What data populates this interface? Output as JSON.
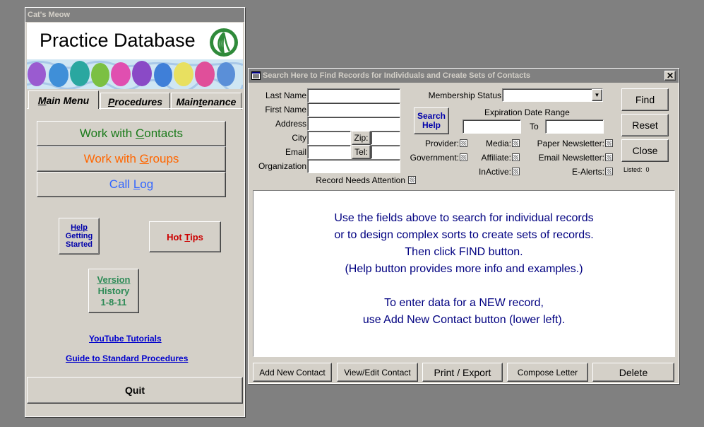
{
  "left_window": {
    "title": "Cat's Meow",
    "header_title": "Practice Database",
    "tabs": [
      {
        "label": "Main Menu",
        "u": "M"
      },
      {
        "label": "Procedures",
        "u": "P"
      },
      {
        "label": "Maintenance",
        "u": "t"
      }
    ],
    "buttons": {
      "contacts": {
        "pre": "Work with ",
        "u": "C",
        "post": "ontacts",
        "color": "#1a7a1a"
      },
      "groups": {
        "pre": "Work with ",
        "u": "G",
        "post": "roups",
        "color": "#ff6600"
      },
      "call_log": {
        "pre": "Call ",
        "u": "L",
        "post": "og",
        "color": "#3366ff"
      },
      "help": {
        "u": "H",
        "l1": "elp",
        "l2": "Getting",
        "l3": "Started",
        "color": "#0000aa"
      },
      "hot_tips": {
        "pre": "Hot ",
        "u": "T",
        "post": "ips",
        "color": "#cc0000"
      },
      "version": {
        "u": "V",
        "l1": "ersion",
        "l2": "History",
        "l3": "1-8-11",
        "color": "#2e8b57"
      },
      "quit": "Quit"
    },
    "links": {
      "youtube": "YouTube Tutorials",
      "guide": "Guide to Standard Procedures"
    }
  },
  "search_window": {
    "title": "Search Here to Find Records for Individuals and Create Sets of Contacts",
    "labels": {
      "last_name": "Last Name",
      "first_name": "First Name",
      "address": "Address",
      "city": "City",
      "zip": "Zip:",
      "email": "Email",
      "tel": "Tel:",
      "organization": "Organization",
      "record_needs_attention": "Record Needs Attention",
      "membership_status": "Membership Status",
      "expiration_date_range": "Expiration Date Range",
      "to": "To",
      "search_help_1": "Search",
      "search_help_2": "Help"
    },
    "checkboxes": {
      "provider": "Provider:",
      "government": "Government:",
      "media": "Media:",
      "affiliate": "Affiliate:",
      "inactive": "InActive:",
      "paper_newsletter": "Paper Newsletter:",
      "email_newsletter": "Email Newsletter:",
      "e_alerts": "E-Alerts:"
    },
    "buttons": {
      "find": "Find",
      "reset": "Reset",
      "close": "Close"
    },
    "listed": "Listed:  0",
    "instructions": [
      "Use the fields above to search for individual records",
      "or to design complex sorts to create sets of records.",
      "Then click FIND button.",
      "(Help button provides more info and examples.)",
      "",
      "To enter data for a NEW record,",
      "use Add New Contact button (lower left)."
    ],
    "instructions_color": "#000080",
    "bottom_buttons": {
      "add_new_contact": "Add New Contact",
      "view_edit_contact": "View/Edit Contact",
      "print_export": "Print / Export",
      "compose_letter": "Compose Letter",
      "delete": "Delete"
    }
  },
  "colors": {
    "face": "#d4d0c8",
    "desktop": "#808080",
    "title_bar": "#808080"
  }
}
